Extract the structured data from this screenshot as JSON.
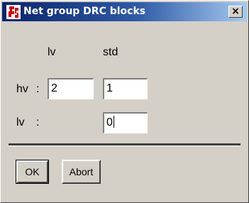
{
  "window": {
    "title": "Net group DRC blocks",
    "close_glyph": "×",
    "app_icon": "app-logo-icon"
  },
  "columns": {
    "col1": "lv",
    "col2": "std"
  },
  "rows": [
    {
      "label": "hv",
      "colon": ":",
      "col1_value": "2",
      "col2_value": "1"
    },
    {
      "label": "lv",
      "colon": ":",
      "col2_value": "0"
    }
  ],
  "buttons": {
    "ok_label": "OK",
    "abort_label": "Abort"
  },
  "colors": {
    "title_start": "#0a246a",
    "title_end": "#a6caf0",
    "icon_red": "#d00000",
    "face": "#d4d0c8"
  }
}
